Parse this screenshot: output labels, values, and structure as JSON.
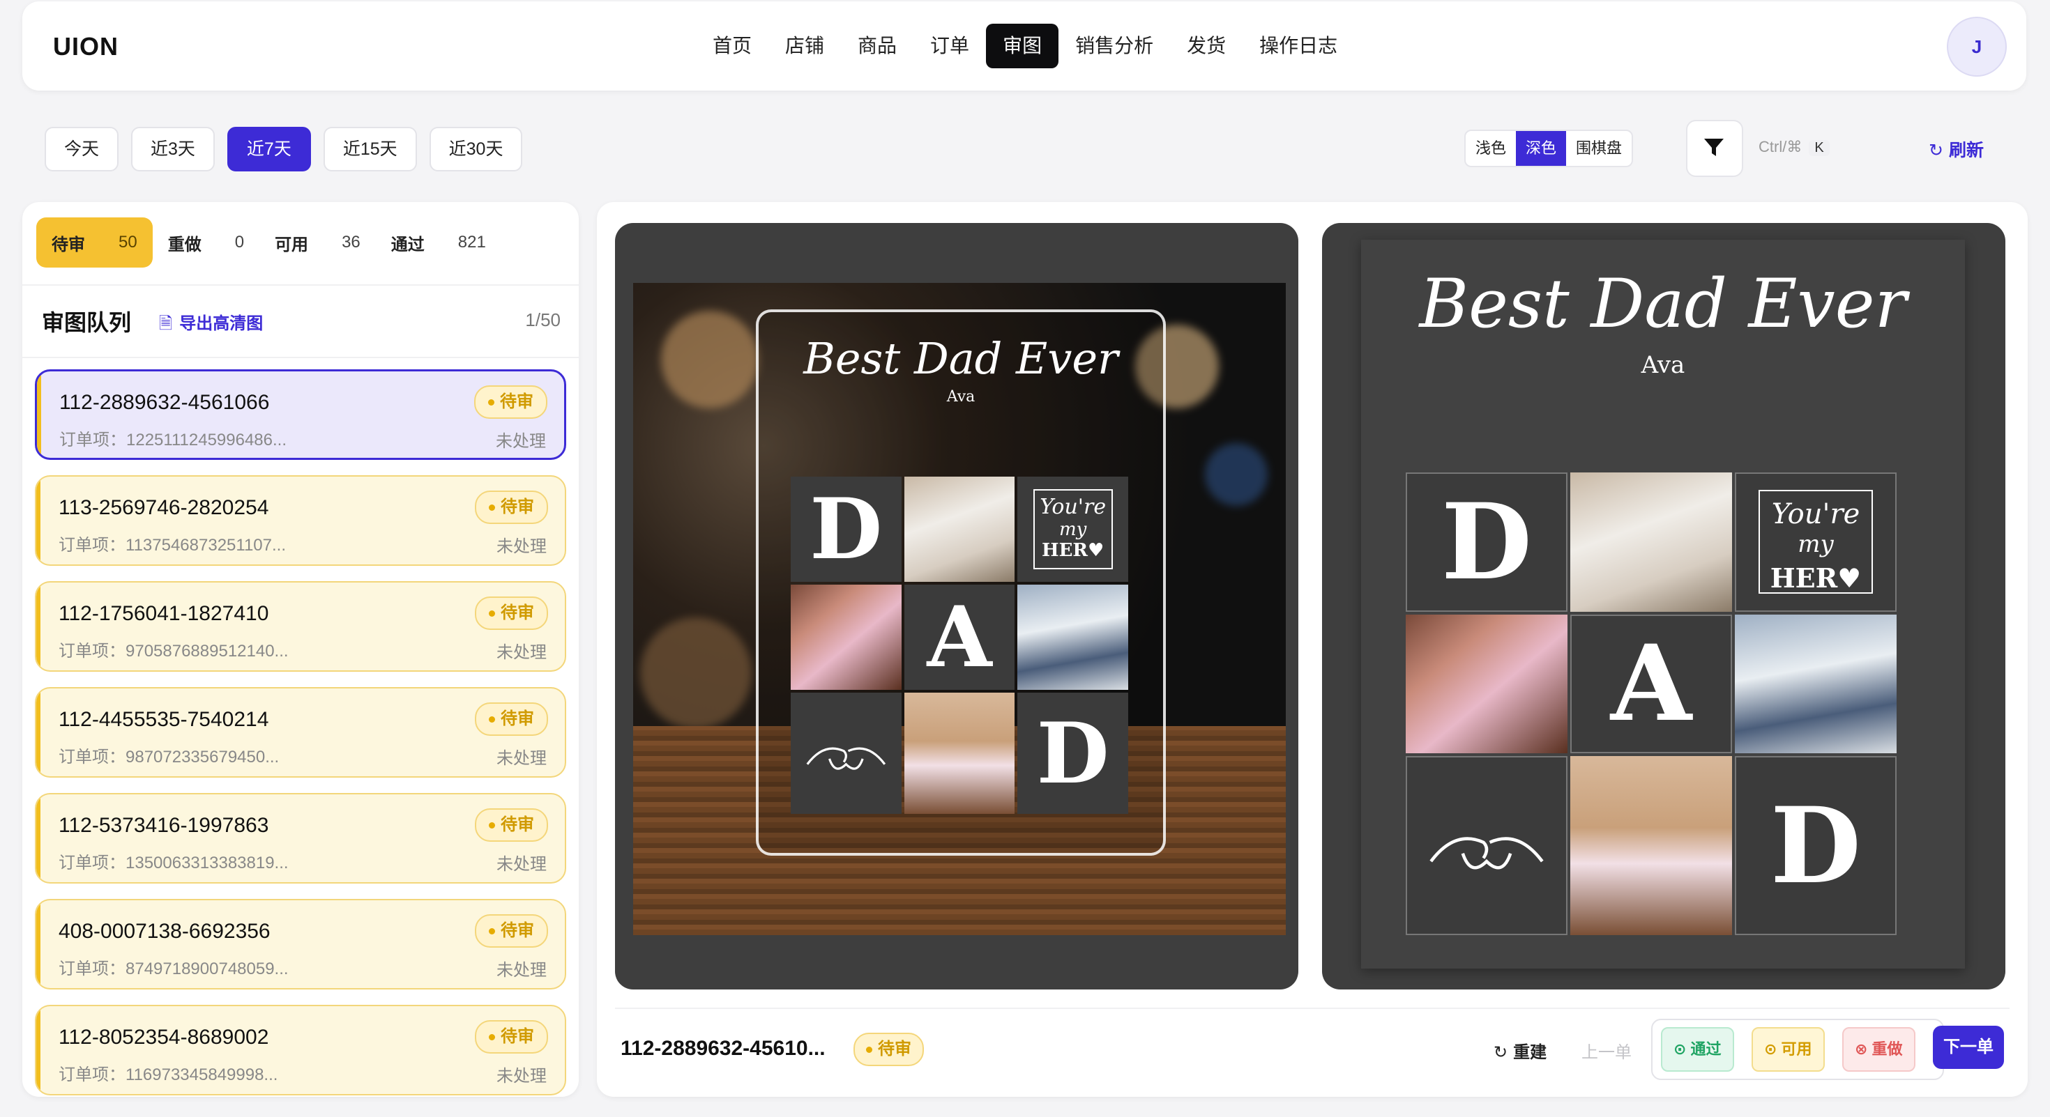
{
  "app": {
    "brand": "UION",
    "avatar_initial": "J"
  },
  "nav": {
    "items": [
      {
        "label": "首页",
        "active": false
      },
      {
        "label": "店铺",
        "active": false
      },
      {
        "label": "商品",
        "active": false
      },
      {
        "label": "订单",
        "active": false
      },
      {
        "label": "审图",
        "active": true
      },
      {
        "label": "销售分析",
        "active": false
      },
      {
        "label": "发货",
        "active": false
      },
      {
        "label": "操作日志",
        "active": false
      }
    ]
  },
  "date_range": {
    "options": [
      "今天",
      "近3天",
      "近7天",
      "近15天",
      "近30天"
    ],
    "selected": "近7天"
  },
  "theme": {
    "options": [
      "浅色",
      "深色",
      "围棋盘"
    ],
    "selected": "深色"
  },
  "filter": {
    "icon": "funnel-icon",
    "shortcut_label": "Ctrl/⌘",
    "shortcut_key": "K"
  },
  "refresh": {
    "icon": "refresh-icon",
    "label": "刷新"
  },
  "stats": [
    {
      "label": "待审",
      "count": "50",
      "active": true
    },
    {
      "label": "重做",
      "count": "0",
      "active": false
    },
    {
      "label": "可用",
      "count": "36",
      "active": false
    },
    {
      "label": "通过",
      "count": "821",
      "active": false
    }
  ],
  "queue": {
    "title": "审图队列",
    "export_label": "导出高清图",
    "position": "1/50",
    "items": [
      {
        "id": "112-2889632-4561066",
        "sub": "订单项：1225111245996486...",
        "badge": "待审",
        "status": "未处理",
        "active": true
      },
      {
        "id": "113-2569746-2820254",
        "sub": "订单项：1137546873251107...",
        "badge": "待审",
        "status": "未处理",
        "active": false
      },
      {
        "id": "112-1756041-1827410",
        "sub": "订单项：9705876889512140...",
        "badge": "待审",
        "status": "未处理",
        "active": false
      },
      {
        "id": "112-4455535-7540214",
        "sub": "订单项：987072335679450...",
        "badge": "待审",
        "status": "未处理",
        "active": false
      },
      {
        "id": "112-5373416-1997863",
        "sub": "订单项：1350063313383819...",
        "badge": "待审",
        "status": "未处理",
        "active": false
      },
      {
        "id": "408-0007138-6692356",
        "sub": "订单项：8749718900748059...",
        "badge": "待审",
        "status": "未处理",
        "active": false
      },
      {
        "id": "112-8052354-8689002",
        "sub": "订单项：116973345849998...",
        "badge": "待审",
        "status": "未处理",
        "active": false
      }
    ]
  },
  "design": {
    "title": "Best Dad Ever",
    "name": "Ava",
    "letter_d": "D",
    "letter_a": "A",
    "hero_line1": "You're",
    "hero_line2": "my",
    "hero_line3": "HER♥"
  },
  "review_bar": {
    "order_id": "112-2889632-45610...",
    "badge": "待审",
    "rebuild_label": "重建",
    "prev_label": "上一单",
    "pass_label": "通过",
    "usable_label": "可用",
    "redo_label": "重做",
    "next_label": "下一单"
  }
}
